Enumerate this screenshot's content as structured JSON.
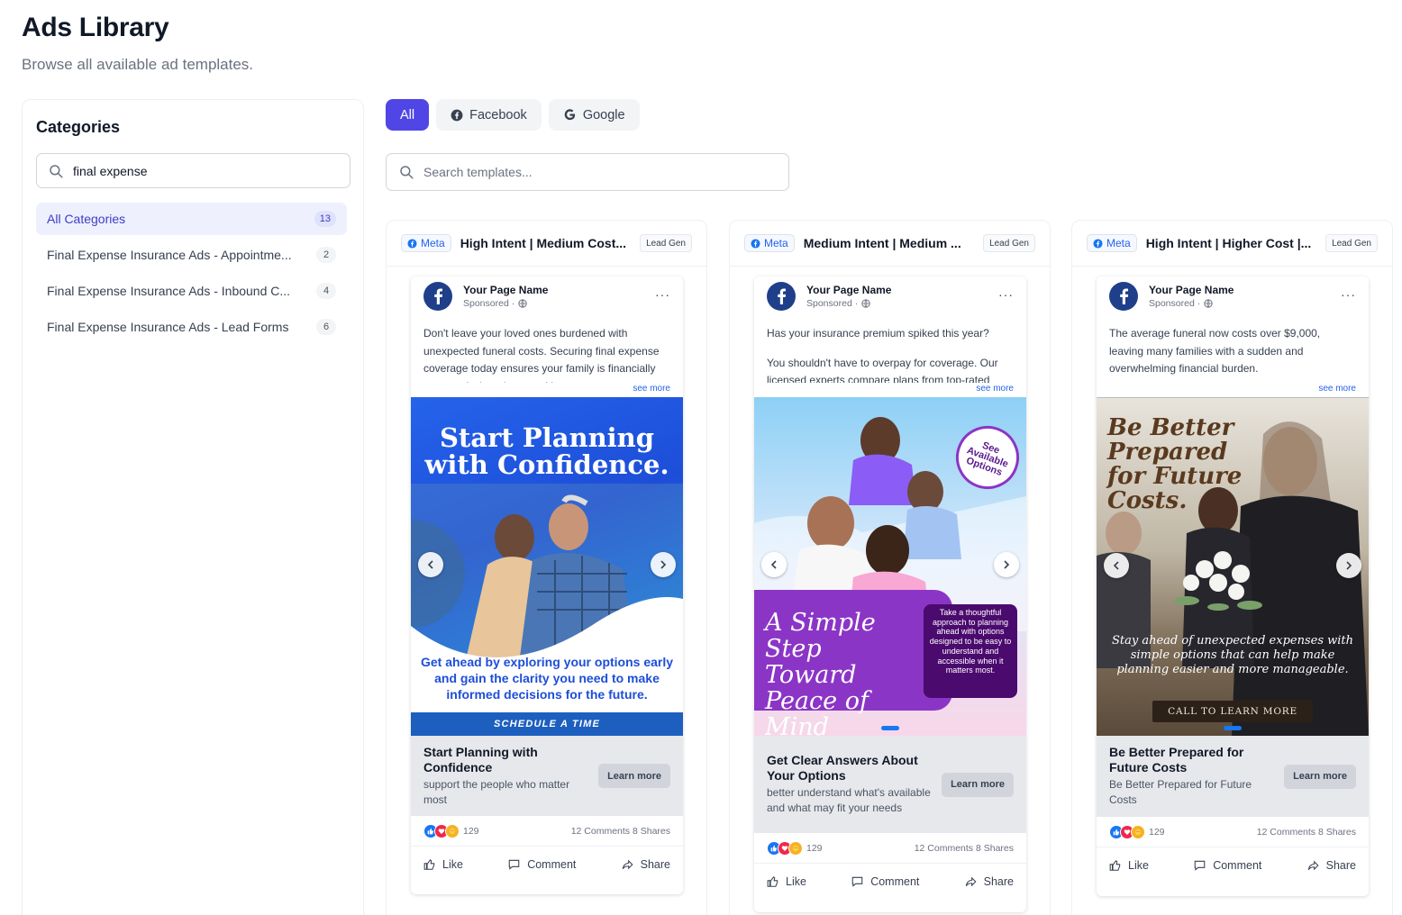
{
  "header": {
    "title": "Ads Library",
    "subtitle": "Browse all available ad templates."
  },
  "sidebar": {
    "title": "Categories",
    "search_value": "final expense",
    "items": [
      {
        "label": "All Categories",
        "count": "13",
        "active": true
      },
      {
        "label": "Final Expense Insurance Ads - Appointme...",
        "count": "2"
      },
      {
        "label": "Final Expense Insurance Ads - Inbound C...",
        "count": "4"
      },
      {
        "label": "Final Expense Insurance Ads - Lead Forms",
        "count": "6"
      }
    ]
  },
  "filters": {
    "all": "All",
    "facebook": "Facebook",
    "google": "Google"
  },
  "template_search": {
    "placeholder": "Search templates..."
  },
  "colors": {
    "accent": "#4f46e5",
    "facebook_blue": "#1877f2",
    "meta_tag": "#2563eb"
  },
  "cards": [
    {
      "platform": "Meta",
      "title": "High Intent | Medium Cost...",
      "tag": "Lead Gen",
      "page_name": "Your Page Name",
      "sponsored": "Sponsored ·",
      "text1": "Don't leave your loved ones burdened with unexpected funeral costs. Securing final expense coverage today ensures your family is financially protected when they need it most.",
      "text2": "",
      "see_more": "see more",
      "creative": {
        "headline": "Start Planning with Confidence.",
        "sub": "Get ahead by exploring your options early and gain the clarity you need to make informed decisions for the future.",
        "bar": "SCHEDULE A TIME"
      },
      "cta_title": "Start Planning with Confidence",
      "cta_desc": "support the people who matter most",
      "learn_more": "Learn more",
      "reactions": "129",
      "stats": "12 Comments 8 Shares",
      "like": "Like",
      "comment": "Comment",
      "share": "Share"
    },
    {
      "platform": "Meta",
      "title": "Medium Intent | Medium ...",
      "tag": "Lead Gen",
      "page_name": "Your Page Name",
      "sponsored": "Sponsored ·",
      "text1": "Has your insurance premium spiked this year?",
      "text2": "You shouldn't have to overpay for coverage. Our licensed experts compare plans from top-rated",
      "see_more": "see more",
      "creative": {
        "badge": "See Available Options",
        "script": "A Simple Step Toward Peace of Mind",
        "box": "Take a thoughtful approach to planning ahead with options designed to be easy to understand and accessible when it matters most."
      },
      "cta_title": "Get Clear Answers About Your Options",
      "cta_desc": "better understand what's available and what may fit your needs",
      "learn_more": "Learn more",
      "reactions": "129",
      "stats": "12 Comments 8 Shares",
      "like": "Like",
      "comment": "Comment",
      "share": "Share"
    },
    {
      "platform": "Meta",
      "title": "High Intent | Higher Cost |...",
      "tag": "Lead Gen",
      "page_name": "Your Page Name",
      "sponsored": "Sponsored ·",
      "text1": "The average funeral now costs over $9,000, leaving many families with a sudden and overwhelming financial burden.",
      "text2": "",
      "see_more": "see more",
      "creative": {
        "headline": "Be Better Prepared for Future Costs.",
        "sub": "Stay ahead of unexpected expenses with simple options that can help make planning easier and more manageable.",
        "cta": "CALL TO LEARN MORE"
      },
      "cta_title": "Be Better Prepared for Future Costs",
      "cta_desc": "Be Better Prepared for Future Costs",
      "learn_more": "Learn more",
      "reactions": "129",
      "stats": "12 Comments 8 Shares",
      "like": "Like",
      "comment": "Comment",
      "share": "Share"
    }
  ]
}
